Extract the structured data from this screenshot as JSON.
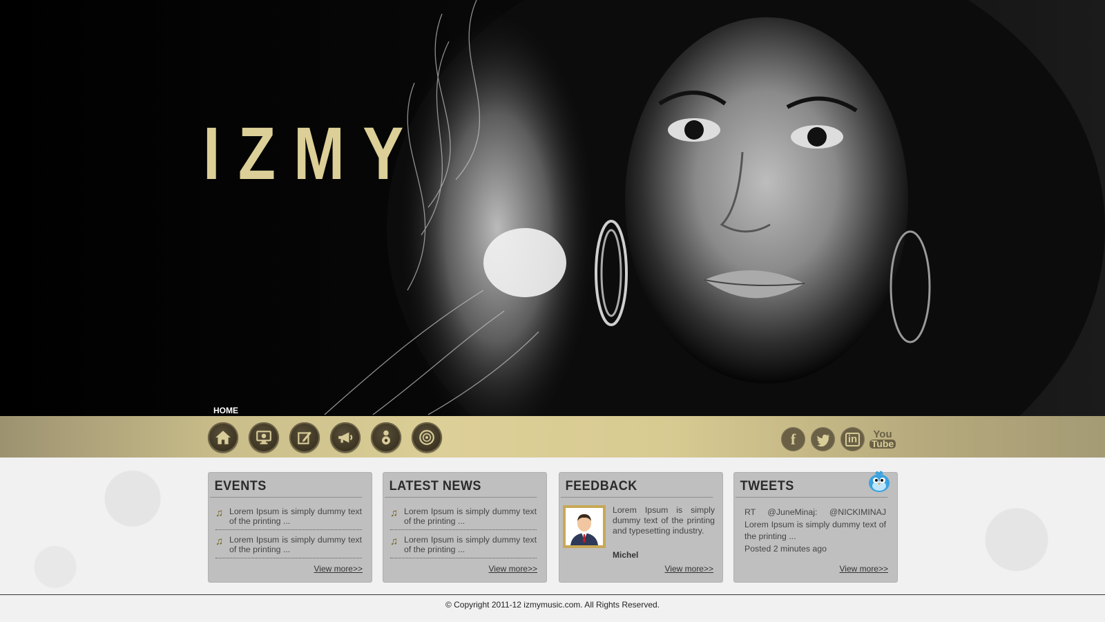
{
  "brand": {
    "title": "IZMY",
    "color": "#dccf97"
  },
  "nav": {
    "current": "HOME",
    "items": [
      {
        "icon": "home-icon"
      },
      {
        "icon": "monitor-icon"
      },
      {
        "icon": "edit-icon"
      },
      {
        "icon": "megaphone-icon"
      },
      {
        "icon": "speaker-icon"
      },
      {
        "icon": "disc-icon"
      }
    ]
  },
  "social": {
    "facebook": "f",
    "twitter": "t",
    "linkedin": "in",
    "youtube_you": "You",
    "youtube_tube": "Tube"
  },
  "events": {
    "title": "EVENTS",
    "items": [
      "Lorem Ipsum is simply dummy text of the printing ...",
      "Lorem Ipsum is simply dummy text of the printing ..."
    ],
    "more": "View more>>"
  },
  "news": {
    "title": "LATEST NEWS",
    "items": [
      "Lorem Ipsum is simply dummy text of the printing ...",
      "Lorem Ipsum is simply dummy text of the printing ..."
    ],
    "more": "View more>>"
  },
  "feedback": {
    "title": "FEEDBACK",
    "text": "Lorem Ipsum is simply dummy text of the printing and typesetting industry.",
    "name": "Michel",
    "more": "View more>>"
  },
  "tweets": {
    "title": "TWEETS",
    "text": "RT @JuneMinaj: @NICKIMINAJ Lorem Ipsum is simply dummy text of the printing ...",
    "posted": "Posted 2 minutes ago",
    "more": "View more>>"
  },
  "footer": {
    "copyright": "© Copyright 2011-12 izmymusic.com. All Rights Reserved."
  }
}
